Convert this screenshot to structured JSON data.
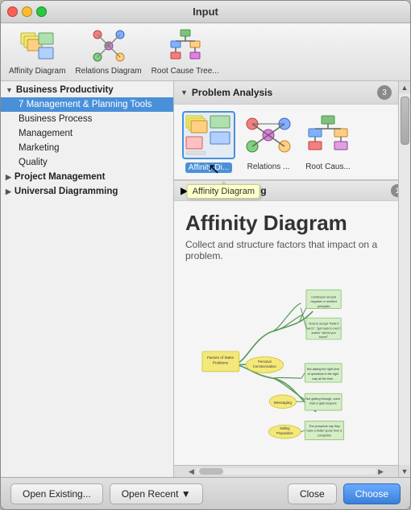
{
  "window": {
    "title": "Input",
    "controls": {
      "close": "close",
      "minimize": "minimize",
      "maximize": "maximize"
    }
  },
  "toolbar": {
    "items": [
      {
        "id": "affinity-diagram",
        "label": "Affinity Diagram"
      },
      {
        "id": "relations-diagram",
        "label": "Relations Diagram"
      },
      {
        "id": "root-cause-tree",
        "label": "Root Cause Tree..."
      }
    ]
  },
  "sidebar": {
    "groups": [
      {
        "id": "business-productivity",
        "label": "Business Productivity",
        "expanded": true,
        "items": [
          {
            "id": "7-management",
            "label": "7 Management & Planning Tools",
            "active": true
          },
          {
            "id": "business-process",
            "label": "Business Process"
          },
          {
            "id": "management",
            "label": "Management"
          },
          {
            "id": "marketing",
            "label": "Marketing"
          },
          {
            "id": "quality",
            "label": "Quality"
          }
        ]
      },
      {
        "id": "project-management",
        "label": "Project Management",
        "expanded": false,
        "items": []
      },
      {
        "id": "universal-diagramming",
        "label": "Universal Diagramming",
        "expanded": false,
        "items": []
      }
    ]
  },
  "right_panel": {
    "problem_analysis": {
      "title": "Problem Analysis",
      "count": "3",
      "templates": [
        {
          "id": "affinity",
          "name": "Affinity Di...",
          "selected": true
        },
        {
          "id": "relations",
          "name": "Relations ...",
          "selected": false
        },
        {
          "id": "root-cause",
          "name": "Root Caus...",
          "selected": false
        }
      ],
      "tooltip": "Affinity Diagram"
    },
    "action_planning": {
      "title": "Action Planning",
      "count": "1"
    },
    "preview": {
      "title": "Affinity Diagram",
      "subtitle": "Collect and structure factors that impact on a problem."
    }
  },
  "bottom_bar": {
    "open_existing": "Open Existing...",
    "open_recent": "Open Recent ▼",
    "close": "Close",
    "choose": "Choose"
  }
}
